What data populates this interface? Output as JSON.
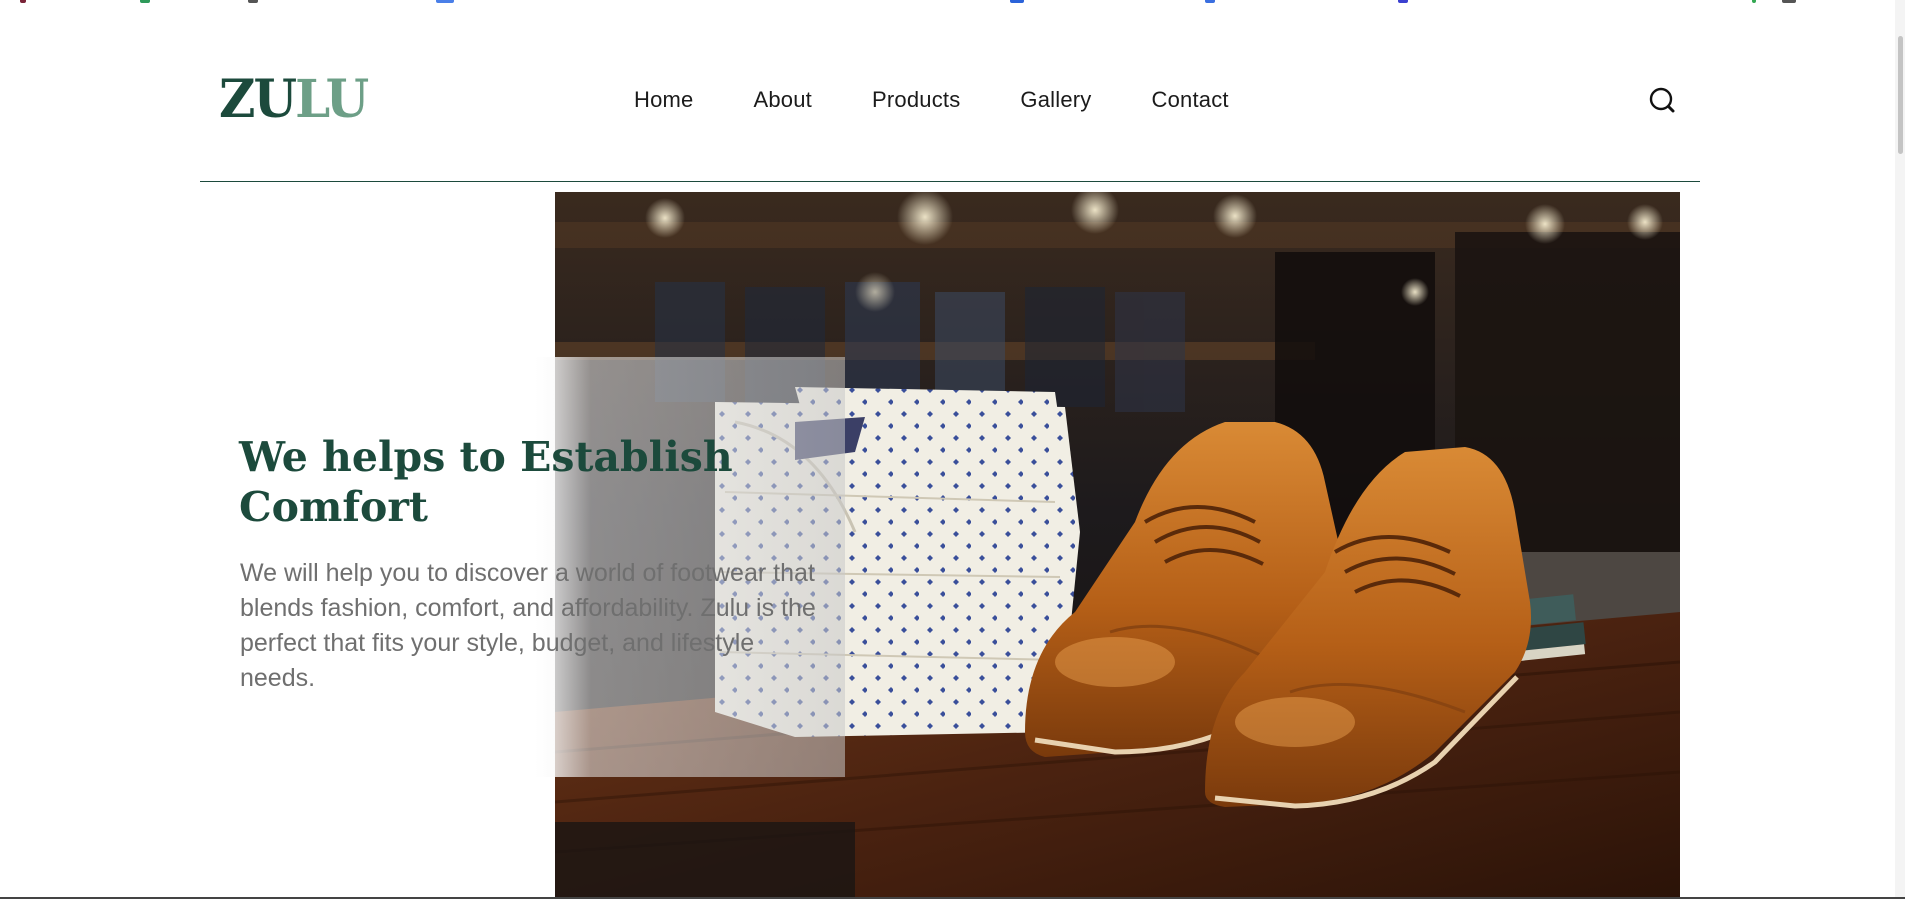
{
  "brand": {
    "logo_part_a": "ZU",
    "logo_part_b": "LU",
    "primary_color": "#1c4a3c",
    "secondary_color": "#6d9f87"
  },
  "nav": {
    "items": [
      {
        "label": "Home"
      },
      {
        "label": "About"
      },
      {
        "label": "Products"
      },
      {
        "label": "Gallery"
      },
      {
        "label": "Contact"
      }
    ]
  },
  "header": {
    "search_icon": "search-icon"
  },
  "hero": {
    "title": "We helps to Establish Comfort",
    "text": "We will help you to discover a world of footwear that blends fashion, comfort, and affordability. Zulu is the perfect that fits your style, budget, and lifestyle needs.",
    "image_subject": "brown leather oxford shoes beside folded patterned shirts on a wooden table"
  }
}
